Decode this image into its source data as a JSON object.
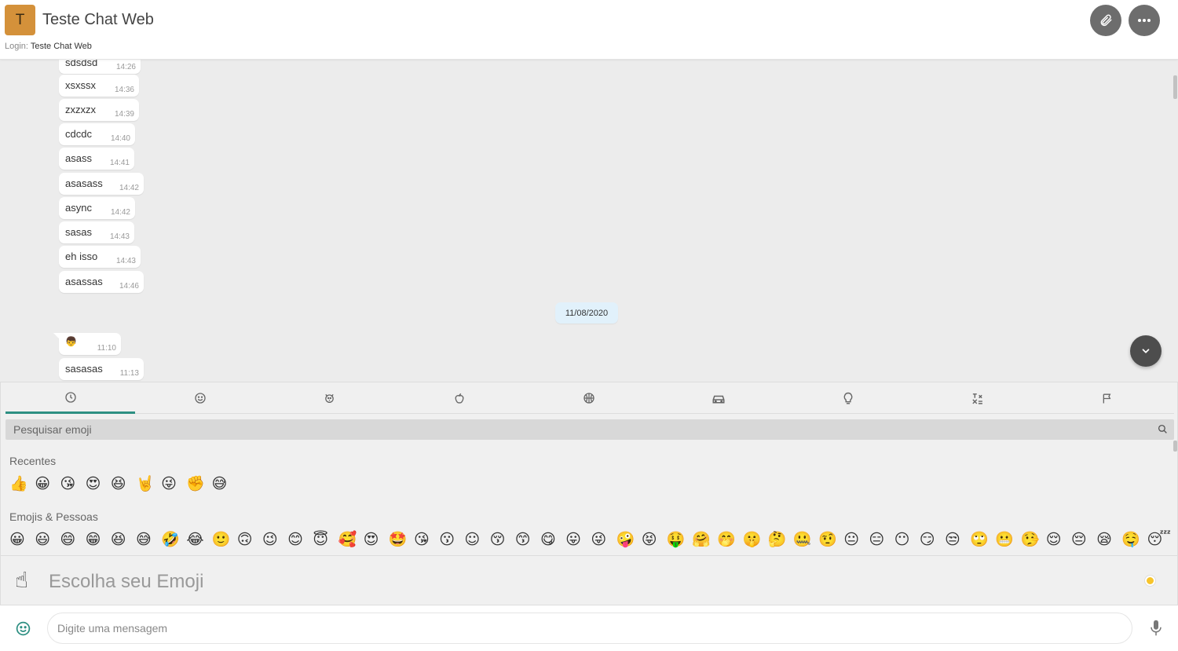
{
  "header": {
    "avatar_letter": "T",
    "title": "Teste Chat Web",
    "login_label": "Login:",
    "login_value": "Teste Chat Web",
    "attach_icon": "paperclip-icon",
    "more_icon": "more-horizontal-icon"
  },
  "messages": [
    {
      "text": "sdsdsd",
      "time": "14:26"
    },
    {
      "text": "xsxssx",
      "time": "14:36"
    },
    {
      "text": "zxzxzx",
      "time": "14:39"
    },
    {
      "text": "cdcdc",
      "time": "14:40"
    },
    {
      "text": "asass",
      "time": "14:41"
    },
    {
      "text": "asasass",
      "time": "14:42"
    },
    {
      "text": "async",
      "time": "14:42"
    },
    {
      "text": "sasas",
      "time": "14:43"
    },
    {
      "text": "eh isso",
      "time": "14:43"
    },
    {
      "text": "asassas",
      "time": "14:46"
    },
    {
      "text": "👦",
      "time": "11:10"
    },
    {
      "text": "sasasas",
      "time": "11:13"
    }
  ],
  "date_separator": "11/08/2020",
  "emoji_picker": {
    "categories": [
      "clock-icon",
      "smiley-icon",
      "animal-icon",
      "food-icon",
      "activity-icon",
      "travel-icon",
      "objects-icon",
      "symbols-icon",
      "flags-icon"
    ],
    "search_placeholder": "Pesquisar emoji",
    "recent_title": "Recentes",
    "recent": [
      "👍",
      "😀",
      "😘",
      "😍",
      "😆",
      "🤘",
      "😜",
      "✊",
      "😅"
    ],
    "people_title": "Emojis & Pessoas",
    "people": [
      "😀",
      "😃",
      "😄",
      "😁",
      "😆",
      "😅",
      "🤣",
      "😂",
      "🙂",
      "🙃",
      "😉",
      "😊",
      "😇",
      "🥰",
      "😍",
      "🤩",
      "😘",
      "😗",
      "☺",
      "😚",
      "😙",
      "😋",
      "😛",
      "😜",
      "🤪",
      "😝",
      "🤑",
      "🤗",
      "🤭",
      "🤫",
      "🤔",
      "🤐",
      "🤨",
      "😐",
      "😑",
      "😶",
      "😏",
      "😒",
      "🙄",
      "😬",
      "🤥",
      "😌",
      "😔",
      "😪",
      "🤤",
      "😴"
    ],
    "preview_emoji": "☝",
    "preview_text": "Escolha seu Emoji",
    "accent": "#2d8f82",
    "tone_color": "#f7c42b"
  },
  "compose": {
    "placeholder": "Digite uma mensagem",
    "emoji_icon": "smiley-icon",
    "mic_icon": "microphone-icon"
  }
}
